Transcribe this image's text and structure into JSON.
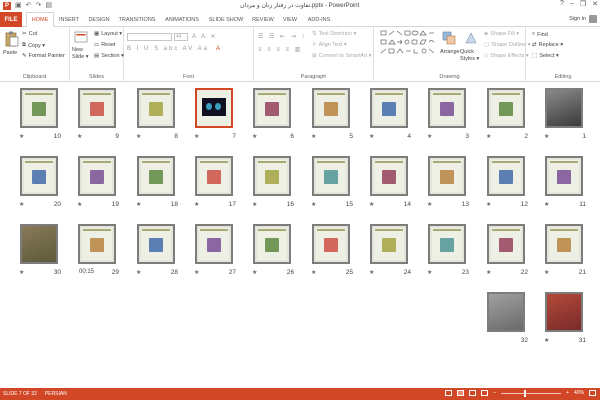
{
  "title_bar": {
    "window_title": "تفاوت در رفتار زنان و مردان.pptx - PowerPoint",
    "app_icon": "P",
    "quick_access": [
      "save-icon",
      "undo-icon",
      "redo-icon",
      "start-from-beginning-icon"
    ],
    "controls": [
      "?",
      "–",
      "❐",
      "✕"
    ]
  },
  "ribbon_tabs": {
    "file": "FILE",
    "tabs": [
      "HOME",
      "INSERT",
      "DESIGN",
      "TRANSITIONS",
      "ANIMATIONS",
      "SLIDE SHOW",
      "REVIEW",
      "VIEW",
      "ADD-INS"
    ],
    "active": "HOME",
    "sign_in": "Sign in"
  },
  "ribbon": {
    "clipboard": {
      "label": "Clipboard",
      "paste": "Paste",
      "cut": "Cut",
      "copy": "Copy ▾",
      "format_painter": "Format Painter"
    },
    "slides": {
      "label": "Slides",
      "new_slide": "New Slide ▾",
      "layout": "Layout ▾",
      "reset": "Reset",
      "section": "Section ▾"
    },
    "font": {
      "label": "Font",
      "font_name": "",
      "font_size": "44"
    },
    "paragraph": {
      "label": "Paragraph",
      "text_direction": "Text Direction ▾",
      "align_text": "Align Text ▾",
      "convert_smartart": "Convert to SmartArt ▾"
    },
    "drawing": {
      "label": "Drawing",
      "arrange": "Arrange",
      "quick_styles": "Quick Styles ▾",
      "shape_fill": "Shape Fill ▾",
      "shape_outline": "Shape Outline ▾",
      "shape_effects": "Shape Effects ▾"
    },
    "editing": {
      "label": "Editing",
      "find": "Find",
      "replace": "Replace ▾",
      "select": "Select ▾"
    }
  },
  "slides": [
    {
      "num": "1",
      "style": "photo",
      "star": "★"
    },
    {
      "num": "2",
      "star": "★"
    },
    {
      "num": "3",
      "star": "★"
    },
    {
      "num": "4",
      "star": "★"
    },
    {
      "num": "5",
      "star": "★"
    },
    {
      "num": "6",
      "star": "★"
    },
    {
      "num": "7",
      "style": "dark",
      "selected": true,
      "star": "★"
    },
    {
      "num": "8",
      "star": "★"
    },
    {
      "num": "9",
      "star": "★"
    },
    {
      "num": "10",
      "star": "★"
    },
    {
      "num": "11",
      "star": "★"
    },
    {
      "num": "12",
      "star": "★"
    },
    {
      "num": "13",
      "star": "★"
    },
    {
      "num": "14",
      "star": "★"
    },
    {
      "num": "15",
      "star": "★"
    },
    {
      "num": "16",
      "star": "★"
    },
    {
      "num": "17",
      "star": "★"
    },
    {
      "num": "18",
      "star": "★"
    },
    {
      "num": "19",
      "star": "★"
    },
    {
      "num": "20",
      "star": "★"
    },
    {
      "num": "21",
      "star": "★"
    },
    {
      "num": "22",
      "star": "★"
    },
    {
      "num": "23",
      "star": "★"
    },
    {
      "num": "24",
      "star": "★"
    },
    {
      "num": "25",
      "star": "★"
    },
    {
      "num": "26",
      "star": "★"
    },
    {
      "num": "27",
      "star": "★"
    },
    {
      "num": "28",
      "star": "★"
    },
    {
      "num": "29",
      "star": "★",
      "duration": "00:15"
    },
    {
      "num": "30",
      "style": "photo",
      "star": "★"
    },
    {
      "num": "31",
      "style": "photo",
      "star": "★"
    },
    {
      "num": "32",
      "style": "photo",
      "star": ""
    }
  ],
  "status_bar": {
    "slide_info": "SLIDE 7 OF 32",
    "language": "PERSIAN",
    "zoom": "40%",
    "zoom_fraction": 0.4
  },
  "colors": {
    "accent": "#d24726",
    "slide_bg": "#e2e5d8",
    "slide_border": "#7d7d7d"
  }
}
